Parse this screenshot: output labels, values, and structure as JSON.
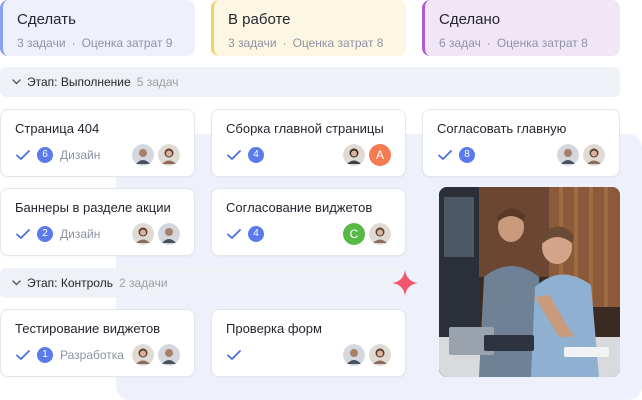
{
  "columns": [
    {
      "title": "Сделать",
      "tasks": "3 задачи",
      "sep": "·",
      "estimate": "Оценка затрат 9",
      "accent": "#8aa0f0"
    },
    {
      "title": "В работе",
      "tasks": "3 задачи",
      "sep": "·",
      "estimate": "Оценка затрат 8",
      "accent": "#f4cf63"
    },
    {
      "title": "Сделано",
      "tasks": "6 задач",
      "sep": "·",
      "estimate": "Оценка затрат 8",
      "accent": "#b25ad3"
    }
  ],
  "stages": [
    {
      "prefix": "Этап:",
      "name": "Выполнение",
      "count": "5 задач"
    },
    {
      "prefix": "Этап:",
      "name": "Контроль",
      "count": "2 задачи"
    }
  ],
  "cards": [
    {
      "title": "Страница 404",
      "badge": "6",
      "tag": "Дизайн"
    },
    {
      "title": "Сборка главной страницы",
      "badge": "4",
      "avatar_letter": "A"
    },
    {
      "title": "Согласовать главную",
      "badge": "8"
    },
    {
      "title": "Баннеры в разделе акции",
      "badge": "2",
      "tag": "Дизайн"
    },
    {
      "title": "Согласование виджетов",
      "badge": "4",
      "avatar_letter": "C"
    },
    {
      "title": "Тестирование виджетов",
      "badge": "1",
      "tag": "Разработка"
    },
    {
      "title": "Проверка форм"
    }
  ],
  "icons": {
    "check": "check-icon",
    "chevron": "chevron-down-icon",
    "sparkle": "sparkle-icon"
  },
  "colors": {
    "accent": "#5b7bec",
    "avatar_orange": "#f47b52",
    "avatar_green": "#58b947",
    "sparkle": "#f0566d"
  }
}
